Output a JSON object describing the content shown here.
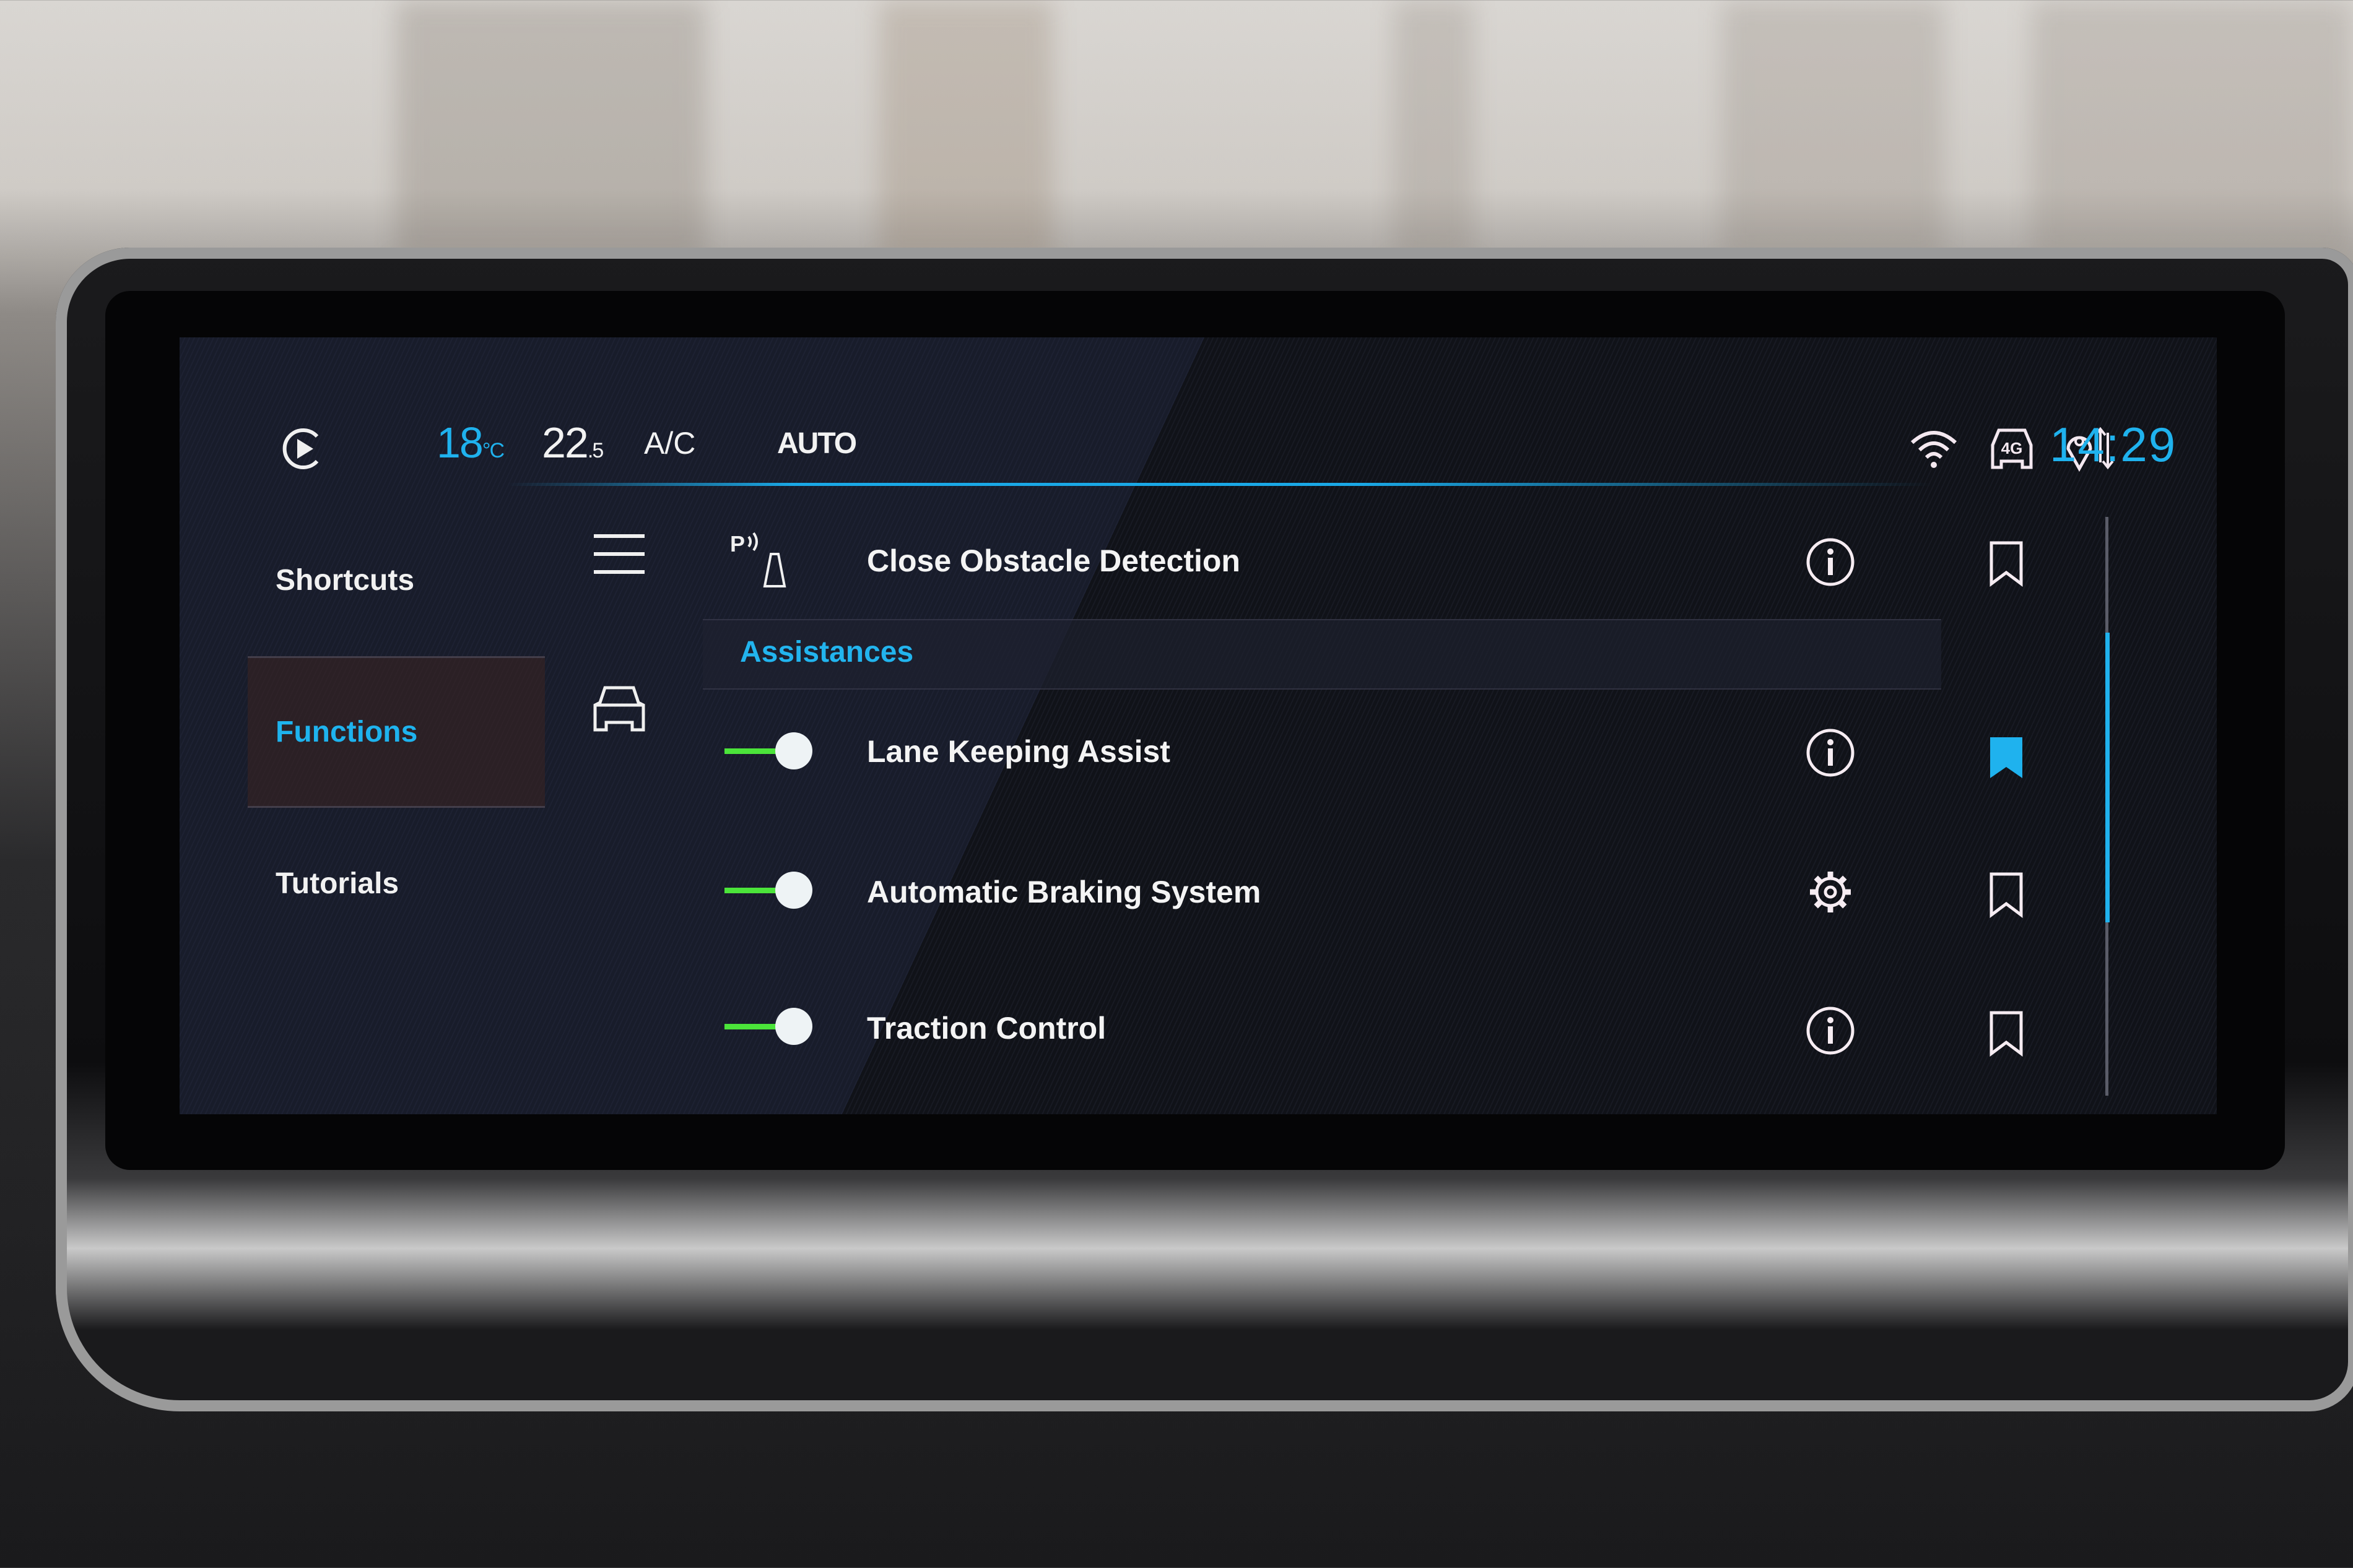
{
  "status_bar": {
    "outside_temp": "18",
    "outside_temp_unit": "°C",
    "cabin_temp": "22",
    "cabin_temp_decimal": ".5",
    "ac_label": "A/C",
    "climate_mode": "AUTO",
    "icons": [
      "media-play-icon",
      "wifi-icon",
      "car-4g-icon",
      "location-sync-icon"
    ],
    "network_label": "4G",
    "clock": "14:29"
  },
  "left_nav": {
    "items": [
      {
        "label": "Shortcuts",
        "active": false
      },
      {
        "label": "Functions",
        "active": true
      },
      {
        "label": "Tutorials",
        "active": false
      }
    ]
  },
  "sub_nav": {
    "icons": [
      "menu-icon",
      "car-icon"
    ]
  },
  "list": {
    "top_item": {
      "label": "Close Obstacle Detection",
      "icon": "park-sensor-icon",
      "icon_text": "P",
      "action_icon": "info-icon",
      "bookmarked": false
    },
    "section_header": "Assistances",
    "items": [
      {
        "label": "Lane Keeping Assist",
        "enabled": true,
        "action_icon": "info-icon",
        "bookmarked": true
      },
      {
        "label": "Automatic Braking System",
        "enabled": true,
        "action_icon": "gear-icon",
        "bookmarked": false
      },
      {
        "label": "Traction Control",
        "enabled": true,
        "action_icon": "info-icon",
        "bookmarked": false
      }
    ]
  },
  "scrollbar": {
    "position_fraction": 0.2,
    "visible_fraction": 0.5
  },
  "colors": {
    "accent": "#1fb2ee",
    "toggle_on": "#4be43a",
    "text": "#f4f4f4",
    "background": "#101218"
  }
}
